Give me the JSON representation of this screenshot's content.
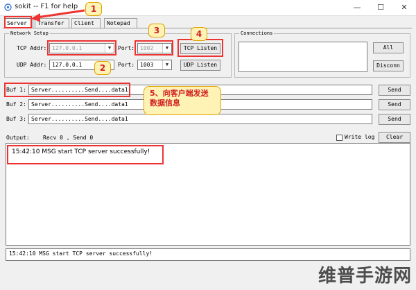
{
  "window": {
    "title": "sokit -- F1 for help",
    "minimize": "—",
    "maximize": "☐",
    "close": "✕"
  },
  "tabs": [
    "Server",
    "Transfer",
    "Client",
    "Notepad"
  ],
  "network_setup": {
    "title": "Network Setup",
    "tcp_addr_label": "TCP Addr:",
    "tcp_addr_value": "127.0.0.1",
    "udp_addr_label": "UDP Addr:",
    "udp_addr_value": "127.0.0.1",
    "tcp_port_label": "Port:",
    "tcp_port_value": "1002",
    "udp_port_label": "Port:",
    "udp_port_value": "1003",
    "tcp_listen": "TCP Listen",
    "udp_listen": "UDP Listen"
  },
  "connections": {
    "title": "Connections",
    "all_button": "All",
    "disconn_button": "Disconn"
  },
  "buffers": [
    {
      "label": "Buf 1:",
      "value": "Server..........Send....data1",
      "send": "Send"
    },
    {
      "label": "Buf 2:",
      "value": "Server..........Send....data1",
      "send": "Send"
    },
    {
      "label": "Buf 3:",
      "value": "Server..........Send....data1",
      "send": "Send"
    }
  ],
  "output": {
    "label": "Output:",
    "counters": "Recv 0 , Send 0",
    "write_log": "Write log",
    "clear": "Clear",
    "log_line": "15:42:10 MSG start TCP server successfully!",
    "status_line": "15:42:10 MSG start TCP server successfully!"
  },
  "annotations": {
    "step1": "1",
    "step2": "2",
    "step3": "3",
    "step4": "4",
    "step5_line1": "5、向客户端发送",
    "step5_line2": "数据信息"
  },
  "watermark": "维普手游网"
}
